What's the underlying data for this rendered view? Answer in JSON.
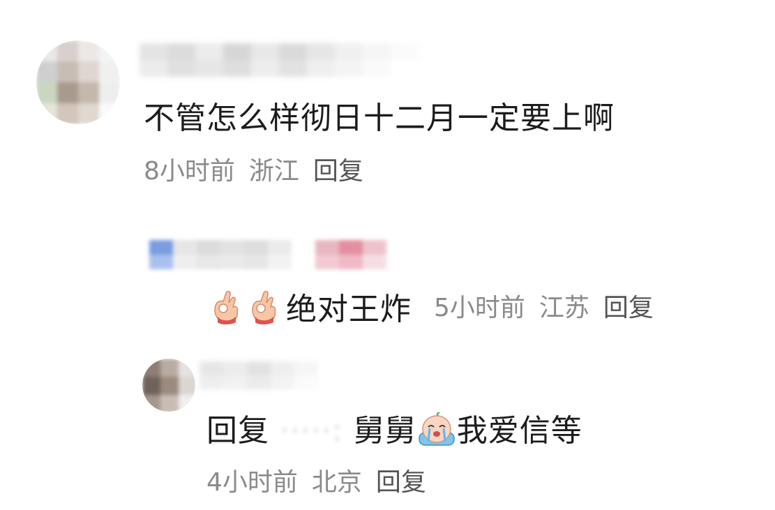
{
  "comments": [
    {
      "text": "不管怎么样彻日十二月一定要上啊",
      "time": "8小时前",
      "location": "浙江",
      "reply_label": "回复"
    },
    {
      "text": "绝对王炸",
      "time": "5小时前",
      "location": "江苏",
      "reply_label": "回复",
      "emojis": [
        "ok-hand-icon",
        "ok-hand-icon"
      ]
    },
    {
      "prefix": "回复",
      "mention": "·····:",
      "text_before_emoji": "舅舅",
      "text_after_emoji": "我爱信等",
      "time": "4小时前",
      "location": "北京",
      "reply_label": "回复",
      "emojis": [
        "crying-face-icon"
      ]
    }
  ],
  "colors": {
    "text": "#1c1c1c",
    "meta": "#8a8a8a",
    "reply": "#555555",
    "background": "#ffffff"
  }
}
